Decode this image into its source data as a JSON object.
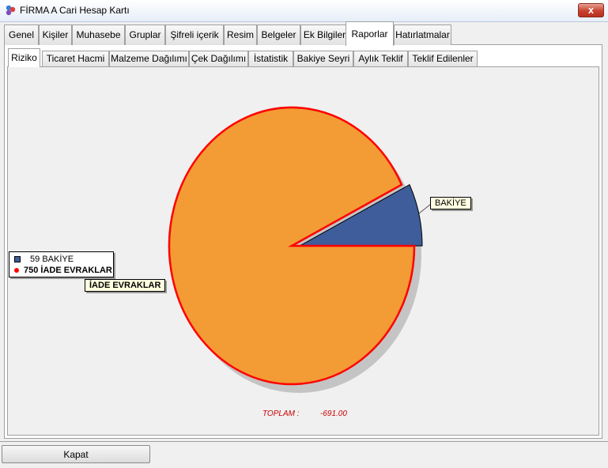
{
  "window": {
    "title": "FİRMA A Cari Hesap Kartı",
    "close_glyph": "x"
  },
  "main_tabs": [
    {
      "label": "Genel"
    },
    {
      "label": "Kişiler"
    },
    {
      "label": "Muhasebe"
    },
    {
      "label": "Gruplar"
    },
    {
      "label": "Şifreli içerik"
    },
    {
      "label": "Resim"
    },
    {
      "label": "Belgeler"
    },
    {
      "label": "Ek Bilgiler"
    },
    {
      "label": "Raporlar",
      "active": true
    },
    {
      "label": "Hatırlatmalar"
    }
  ],
  "sub_tabs": [
    {
      "label": "Riziko",
      "active": true
    },
    {
      "label": "Ticaret Hacmi"
    },
    {
      "label": "Malzeme Dağılımı"
    },
    {
      "label": "Çek Dağılımı"
    },
    {
      "label": "İstatistik"
    },
    {
      "label": "Bakiye Seyri"
    },
    {
      "label": "Aylık Teklif"
    },
    {
      "label": "Teklif Edilenler"
    }
  ],
  "chart_data": {
    "type": "pie",
    "slices": [
      {
        "name": "BAKİYE",
        "value": 59,
        "color": "#3e5d9a"
      },
      {
        "name": "İADE EVRAKLAR",
        "value": 750,
        "color": "#f39b35"
      }
    ],
    "legend": [
      {
        "value_text": "59",
        "label": "BAKİYE"
      },
      {
        "value_text": "750",
        "label": "İADE EVRAKLAR"
      }
    ],
    "total": {
      "label": "TOPLAM :",
      "value": "-691.00"
    },
    "legend_placement": "left"
  },
  "colors": {
    "exploded_outline": "#ff0000",
    "legend_bullet": "#ff0000",
    "accent": "#cc0000"
  },
  "footer": {
    "close_label": "Kapat"
  }
}
